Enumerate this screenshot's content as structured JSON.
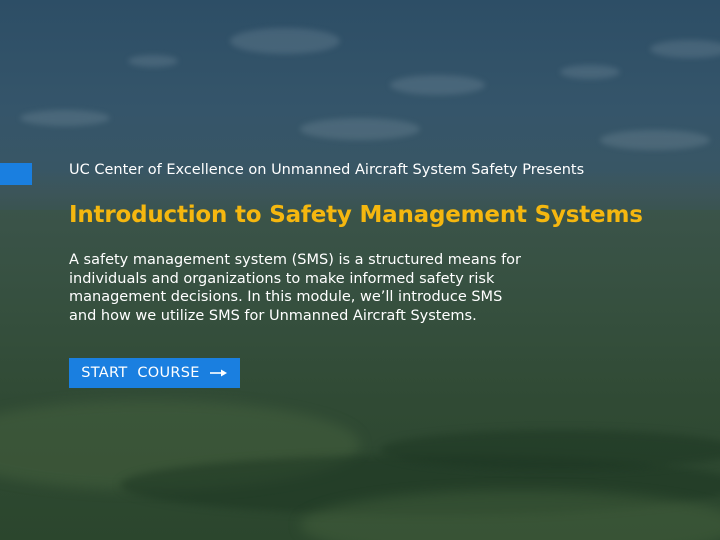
{
  "header": {
    "presenter_text": "UC Center of Excellence on Unmanned Aircraft System Safety Presents"
  },
  "main": {
    "title": "Introduction to Safety Management Systems",
    "description": "A safety management system (SMS) is a structured means for\nindividuals and organizations to make informed safety risk\nmanagement decisions.  In this module, we’ll introduce SMS\nand how we utilize SMS for Unmanned Aircraft Systems."
  },
  "cta": {
    "start_label": "START  COURSE",
    "icon": "arrow-right-icon"
  },
  "colors": {
    "accent": "#1a7fe0",
    "title": "#f5b70f",
    "text": "#ffffff"
  }
}
